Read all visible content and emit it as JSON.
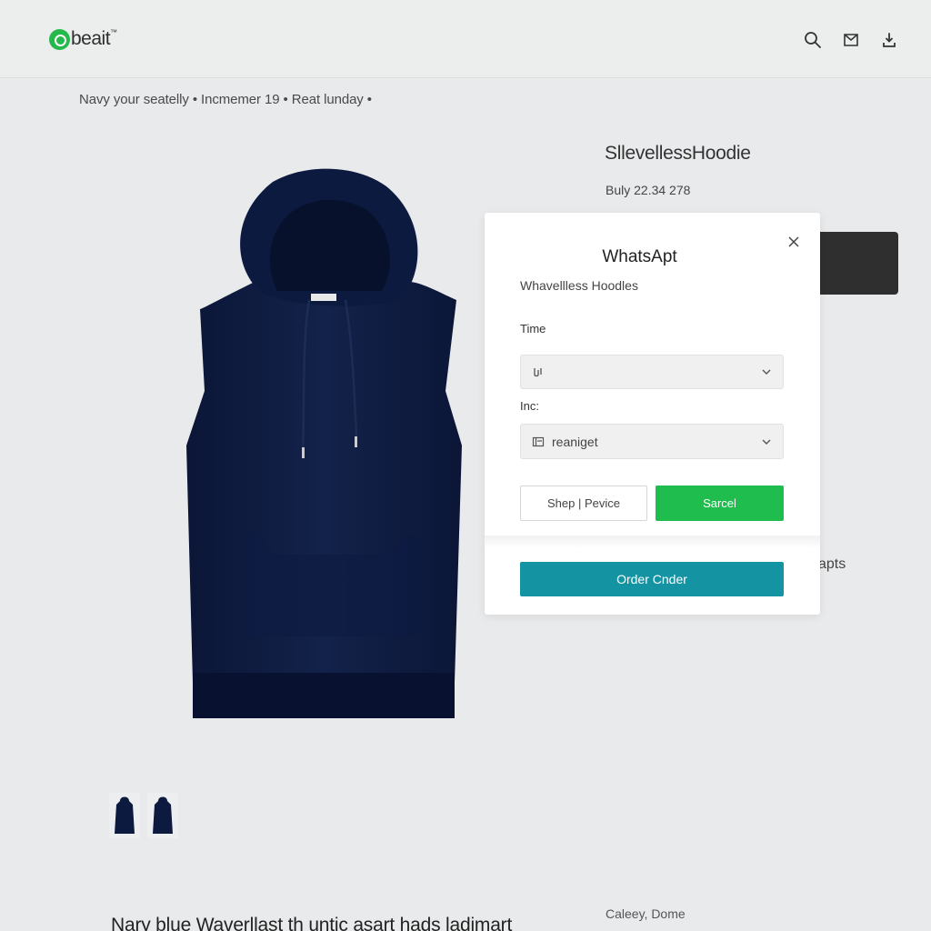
{
  "header": {
    "logo_text": "beait",
    "logo_tm": "™",
    "icons": [
      "search-icon",
      "cart-icon",
      "account-icon"
    ]
  },
  "breadcrumb": "Navy your seatelly • Incmemer 19 • Reat lunday •",
  "product": {
    "title": "SllevellessHoodie",
    "price": "Buly 22.34 278",
    "color": "#0d1a3d",
    "thumbnail_count": 2
  },
  "side_snippet": "apts",
  "bottom": {
    "description": "Nary blue Waverllast th untic asart hads ladimart",
    "right_text": "Caleey, Dome"
  },
  "modal": {
    "title": "WhatsApt",
    "subtitle": "Whavellless Hoodles",
    "field1": {
      "label": "Time",
      "value": ""
    },
    "field2": {
      "label": "Inc:",
      "value": "reaniget"
    },
    "secondary_button": "Shep | Pevice",
    "primary_button": "Sarcel",
    "order_button": "Order Cnder"
  },
  "colors": {
    "primary_green": "#1ebd4e",
    "order_teal": "#1493a3",
    "background": "#e9eaeb"
  }
}
